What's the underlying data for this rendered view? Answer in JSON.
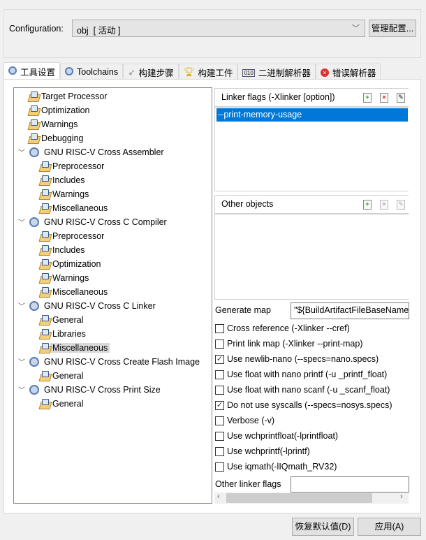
{
  "config": {
    "label": "Configuration:",
    "value": "obj  [ 活动 ]",
    "manage": "管理配置..."
  },
  "tabs": [
    {
      "label": "工具设置",
      "icon": "gear-icon"
    },
    {
      "label": "Toolchains",
      "icon": "gear-icon"
    },
    {
      "label": "构建步骤",
      "icon": "build-steps-icon"
    },
    {
      "label": "构建工件",
      "icon": "trophy-icon"
    },
    {
      "label": "二进制解析器",
      "icon": "binary-icon"
    },
    {
      "label": "错误解析器",
      "icon": "error-icon"
    }
  ],
  "tree": [
    {
      "label": "Target Processor",
      "level": 0
    },
    {
      "label": "Optimization",
      "level": 0
    },
    {
      "label": "Warnings",
      "level": 0
    },
    {
      "label": "Debugging",
      "level": 0
    },
    {
      "label": "GNU RISC-V Cross Assembler",
      "level": "group"
    },
    {
      "label": "Preprocessor",
      "level": 1
    },
    {
      "label": "Includes",
      "level": 1
    },
    {
      "label": "Warnings",
      "level": 1
    },
    {
      "label": "Miscellaneous",
      "level": 1
    },
    {
      "label": "GNU RISC-V Cross C Compiler",
      "level": "group"
    },
    {
      "label": "Preprocessor",
      "level": 1
    },
    {
      "label": "Includes",
      "level": 1
    },
    {
      "label": "Optimization",
      "level": 1
    },
    {
      "label": "Warnings",
      "level": 1
    },
    {
      "label": "Miscellaneous",
      "level": 1
    },
    {
      "label": "GNU RISC-V Cross C Linker",
      "level": "group"
    },
    {
      "label": "General",
      "level": 1
    },
    {
      "label": "Libraries",
      "level": 1
    },
    {
      "label": "Miscellaneous",
      "level": 1,
      "selected": true
    },
    {
      "label": "GNU RISC-V Cross Create Flash Image",
      "level": "group"
    },
    {
      "label": "General",
      "level": 1
    },
    {
      "label": "GNU RISC-V Cross Print Size",
      "level": "group"
    },
    {
      "label": "General",
      "level": 1
    }
  ],
  "linker_flags": {
    "title": "Linker flags (-Xlinker [option])",
    "items": [
      "--print-memory-usage"
    ]
  },
  "other_objects": {
    "title": "Other objects"
  },
  "generate_map": {
    "label": "Generate map",
    "value": "\"${BuildArtifactFileBaseName"
  },
  "checkboxes": [
    {
      "label": "Cross reference (-Xlinker --cref)",
      "checked": false
    },
    {
      "label": "Print link map (-Xlinker --print-map)",
      "checked": false
    },
    {
      "label": "Use newlib-nano (--specs=nano.specs)",
      "checked": true
    },
    {
      "label": "Use float with nano printf (-u _printf_float)",
      "checked": false
    },
    {
      "label": "Use float with nano scanf (-u _scanf_float)",
      "checked": false
    },
    {
      "label": "Do not use syscalls (--specs=nosys.specs)",
      "checked": true
    },
    {
      "label": "Verbose (-v)",
      "checked": false
    },
    {
      "label": "Use wchprintfloat(-lprintfloat)",
      "checked": false
    },
    {
      "label": "Use wchprintf(-lprintf)",
      "checked": false
    },
    {
      "label": "Use iqmath(-lIQmath_RV32)",
      "checked": false
    }
  ],
  "other_linker_flags": {
    "label": "Other linker flags",
    "value": ""
  },
  "buttons": {
    "restore": "恢复默认值(D)",
    "apply": "应用(A)"
  }
}
